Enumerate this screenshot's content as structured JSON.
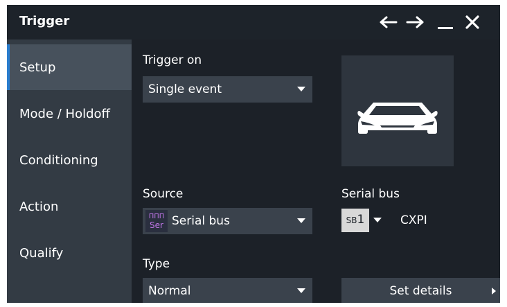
{
  "window": {
    "title": "Trigger",
    "controls": [
      "back-arrow-icon",
      "forward-arrow-icon",
      "minimize-icon",
      "close-icon"
    ]
  },
  "sidebar": {
    "items": [
      {
        "label": "Setup",
        "active": true
      },
      {
        "label": "Mode / Holdoff",
        "active": false
      },
      {
        "label": "Conditioning",
        "active": false
      },
      {
        "label": "Action",
        "active": false
      },
      {
        "label": "Qualify",
        "active": false
      }
    ]
  },
  "setup": {
    "trigger_on_label": "Trigger on",
    "trigger_on_value": "Single event",
    "source_label": "Source",
    "source_icon_top": "ΠΠΠ",
    "source_icon_bottom": "Ser",
    "source_value": "Serial bus",
    "serial_bus_label": "Serial bus",
    "serial_bus_prefix": "SB",
    "serial_bus_number": "1",
    "serial_bus_protocol": "CXPI",
    "type_label": "Type",
    "type_value": "Normal",
    "set_details_label": "Set details"
  },
  "colors": {
    "accent": "#2a7ecf",
    "window_bg": "#1c2128",
    "sidebar_bg": "#333b44",
    "sidebar_active_bg": "#47515c",
    "control_bg": "#3a424c",
    "serial_icon": "#c077e8"
  }
}
